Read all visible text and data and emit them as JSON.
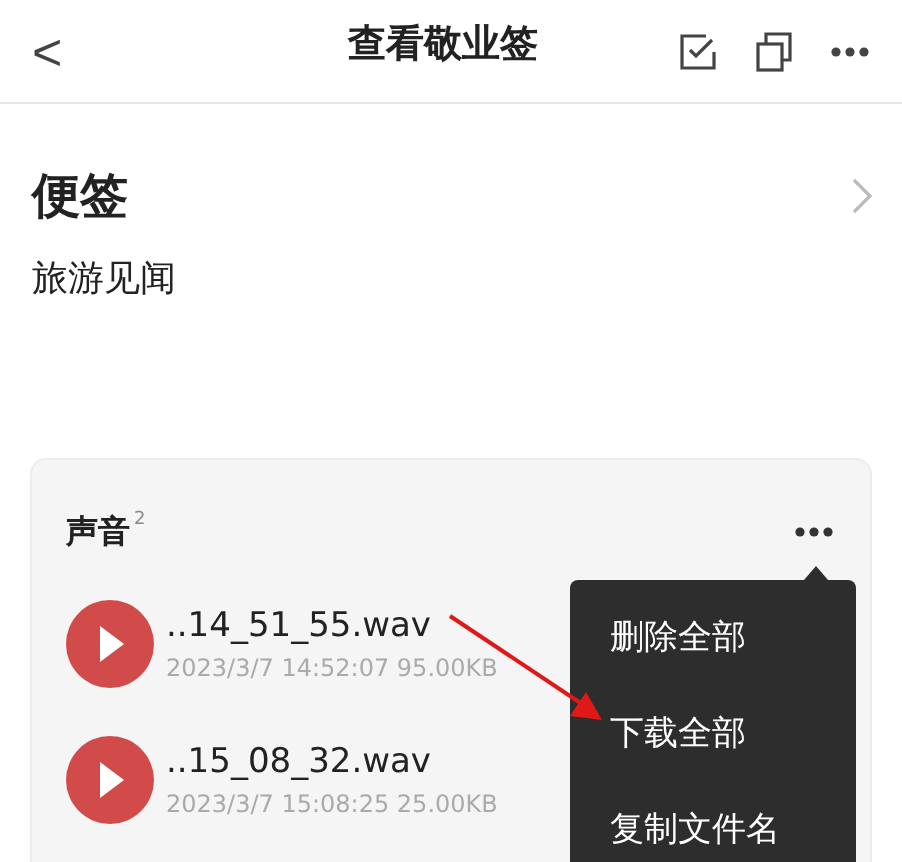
{
  "header": {
    "back": "<",
    "title": "查看敬业签"
  },
  "note": {
    "category": "便签",
    "content": "旅游见闻"
  },
  "card": {
    "title": "声音",
    "count": "2",
    "files": [
      {
        "name": "..14_51_55.wav",
        "meta": "2023/3/7 14:52:07 95.00KB"
      },
      {
        "name": "..15_08_32.wav",
        "meta": "2023/3/7 15:08:25 25.00KB"
      }
    ]
  },
  "menu": [
    "删除全部",
    "下载全部",
    "复制文件名"
  ]
}
